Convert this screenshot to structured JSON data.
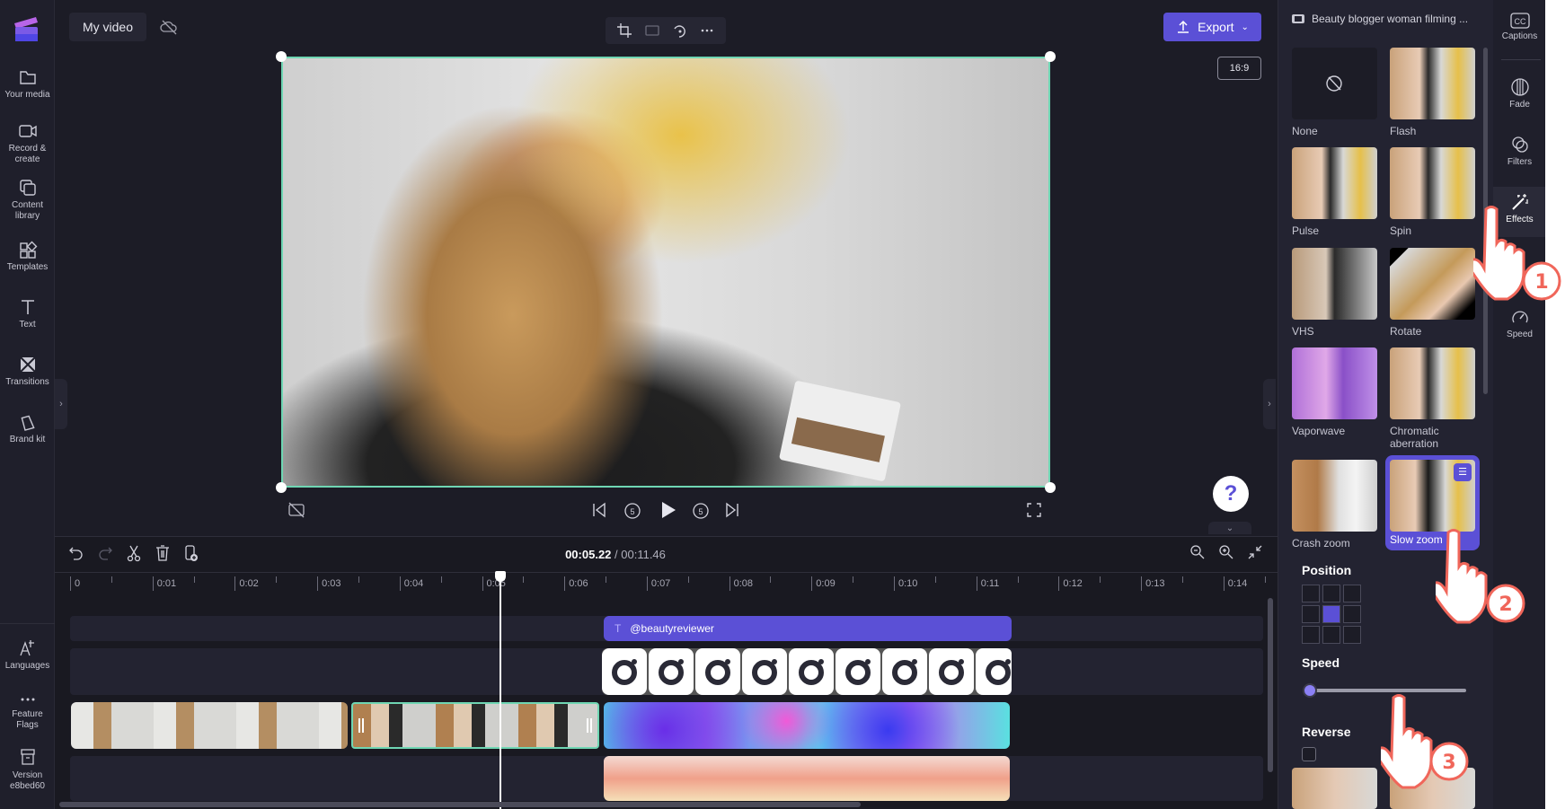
{
  "app": {
    "project_title": "My video",
    "aspect_ratio": "16:9",
    "export_label": "Export",
    "help_label": "?"
  },
  "left_nav": {
    "items": [
      {
        "label": "Your media",
        "icon": "folder-icon"
      },
      {
        "label": "Record & create",
        "icon": "camera-icon"
      },
      {
        "label": "Content library",
        "icon": "library-icon"
      },
      {
        "label": "Templates",
        "icon": "templates-icon"
      },
      {
        "label": "Text",
        "icon": "text-icon"
      },
      {
        "label": "Transitions",
        "icon": "transitions-icon"
      },
      {
        "label": "Brand kit",
        "icon": "brand-kit-icon"
      }
    ],
    "bottom_items": [
      {
        "label": "Languages",
        "icon": "languages-icon"
      },
      {
        "label": "Feature Flags",
        "icon": "more-icon"
      },
      {
        "label": "Version e8bed60",
        "icon": "archive-icon"
      }
    ]
  },
  "timeline": {
    "current_time": "00:05.22",
    "total_time": "/ 00:11.46",
    "ruler": [
      "0",
      "0:01",
      "0:02",
      "0:03",
      "0:04",
      "0:05",
      "0:06",
      "0:07",
      "0:08",
      "0:09",
      "0:10",
      "0:11",
      "0:12",
      "0:13",
      "0:14"
    ],
    "text_clip": "@beautyreviewer",
    "playhead_seconds": 5.22
  },
  "panel": {
    "clip_title": "Beauty blogger woman filming ...",
    "effects": [
      {
        "label": "None"
      },
      {
        "label": "Flash"
      },
      {
        "label": "Pulse"
      },
      {
        "label": "Spin"
      },
      {
        "label": "VHS"
      },
      {
        "label": "Rotate"
      },
      {
        "label": "Vaporwave"
      },
      {
        "label": "Chromatic aberration"
      },
      {
        "label": "Crash zoom"
      },
      {
        "label": "Slow zoom",
        "selected": true
      }
    ],
    "position_label": "Position",
    "position_selected": "center",
    "speed_label": "Speed",
    "speed_value": 0,
    "reverse_label": "Reverse",
    "reverse_checked": false
  },
  "right_tabs": [
    {
      "label": "Captions"
    },
    {
      "label": "Fade"
    },
    {
      "label": "Filters"
    },
    {
      "label": "Effects",
      "active": true
    },
    {
      "label": "Speed"
    }
  ],
  "annotations": [
    "1",
    "2",
    "3"
  ],
  "colors": {
    "accent": "#5b50d6",
    "selection": "#6fd6b3",
    "annotation": "#f0665a"
  }
}
